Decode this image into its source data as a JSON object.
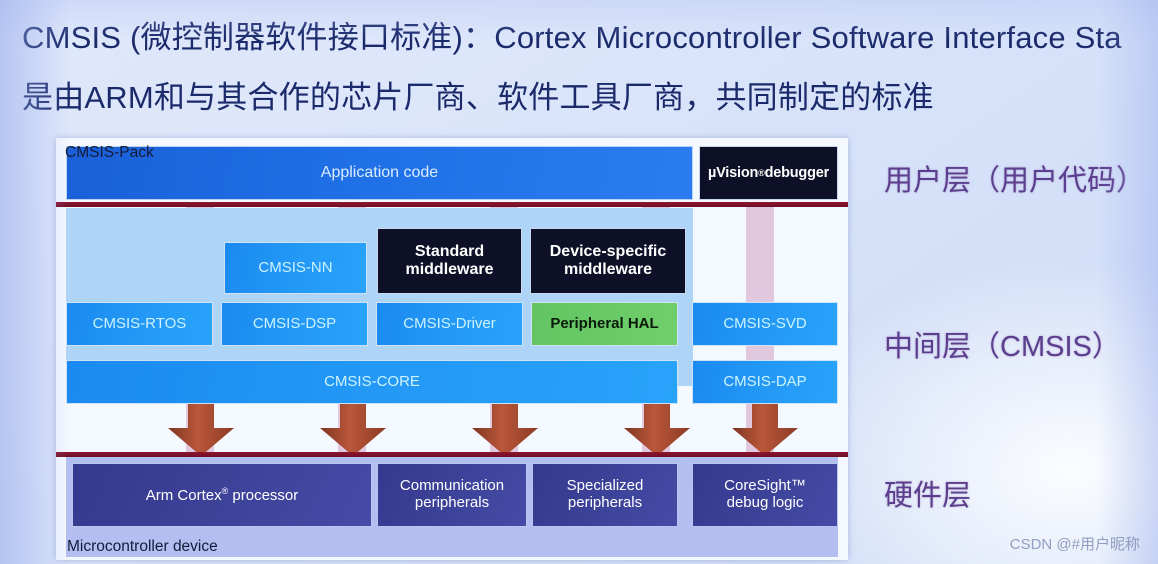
{
  "header": {
    "line1": "CMSIS (微控制器软件接口标准)：Cortex Microcontroller Software Interface Sta",
    "line2": "是由ARM和与其合作的芯片厂商、软件工具厂商，共同制定的标准"
  },
  "diagram": {
    "application_row": {
      "app_code": "Application code",
      "uvision_debugger": "µVision",
      "uvision_sup": "®",
      "uvision_suffix": " debugger"
    },
    "pack_label": "CMSIS-Pack",
    "middleware_row": [
      {
        "label": "CMSIS-NN",
        "style": "blue"
      },
      {
        "label": "Standard middleware",
        "line1": "Standard",
        "line2": "middleware",
        "style": "dark"
      },
      {
        "label": "Device-specific middleware",
        "line1": "Device-specific",
        "line2": "middleware",
        "style": "dark"
      }
    ],
    "component_row": [
      {
        "label": "CMSIS-RTOS",
        "style": "blue"
      },
      {
        "label": "CMSIS-DSP",
        "style": "blue"
      },
      {
        "label": "CMSIS-Driver",
        "style": "blue"
      },
      {
        "label": "Peripheral HAL",
        "style": "green"
      },
      {
        "label": "CMSIS-SVD",
        "style": "blue"
      }
    ],
    "core_row": [
      {
        "label": "CMSIS-CORE",
        "style": "blue"
      },
      {
        "label": "CMSIS-DAP",
        "style": "blue"
      }
    ],
    "hardware_row": [
      {
        "label": "Arm Cortex processor",
        "line1": "Arm Cortex",
        "sup": "®",
        "line1_suffix": " processor",
        "line2": "",
        "style": "navy"
      },
      {
        "line1": "Communication",
        "line2": "peripherals",
        "label": "Communication peripherals",
        "style": "navy"
      },
      {
        "line1": "Specialized",
        "line2": "peripherals",
        "label": "Specialized peripherals",
        "style": "navy"
      },
      {
        "line1": "CoreSight™",
        "line2": "debug logic",
        "label": "CoreSight debug logic",
        "style": "navy"
      }
    ],
    "mcu_label": "Microcontroller device",
    "arrow_count": 5,
    "colors": {
      "arrow": "#a9482d",
      "maroon_divider": "#7d1229",
      "blue_box": "#2398f5",
      "dark_box": "#0d1026",
      "green_box": "#6fcf6a",
      "navy_box": "#3d4299",
      "pack_bg": "#aed4f7",
      "mcu_bg": "#b3bff0",
      "panel_bg": "#f4f8ff"
    }
  },
  "annotations": {
    "user_layer": "用户层（用户代码）",
    "middle_layer": "中间层（CMSIS）",
    "hardware_layer": "硬件层"
  },
  "watermark": "CSDN @#用户昵称"
}
